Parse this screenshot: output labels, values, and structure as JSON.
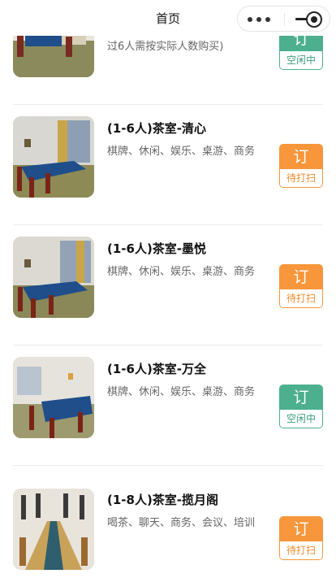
{
  "nav": {
    "title": "首页"
  },
  "rooms": [
    {
      "name": "",
      "tags": "过6人需按实际人数购买)",
      "book_label": "订",
      "status": "空闲中",
      "status_color": "#4caf8d"
    },
    {
      "name": "(1-6人)茶室-清心",
      "tags": "棋牌、休闲、娱乐、桌游、商务",
      "book_label": "订",
      "status": "待打扫",
      "status_color": "#f7963a"
    },
    {
      "name": "(1-6人)茶室-墨悦",
      "tags": "棋牌、休闲、娱乐、桌游、商务",
      "book_label": "订",
      "status": "待打扫",
      "status_color": "#f7963a"
    },
    {
      "name": "(1-6人)茶室-万全",
      "tags": "棋牌、休闲、娱乐、桌游、商务",
      "book_label": "订",
      "status": "空闲中",
      "status_color": "#4caf8d"
    },
    {
      "name": "(1-8人)茶室-揽月阁",
      "tags": "喝茶、聊天、商务、会议、培训",
      "book_label": "订",
      "status": "待打扫",
      "status_color": "#f7963a"
    }
  ]
}
